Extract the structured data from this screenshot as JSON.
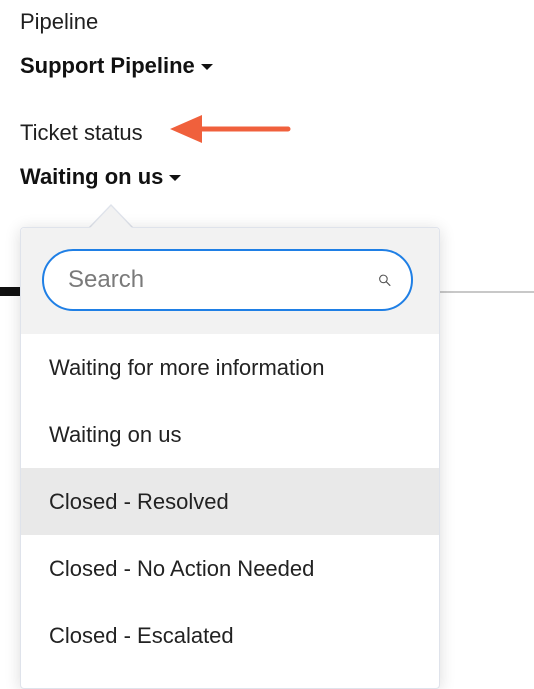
{
  "pipeline": {
    "label": "Pipeline",
    "value": "Support Pipeline"
  },
  "ticket_status": {
    "label": "Ticket status",
    "value": "Waiting on us"
  },
  "search": {
    "placeholder": "Search",
    "icon": "search-icon"
  },
  "options": [
    {
      "label": "Waiting for more information",
      "highlighted": false
    },
    {
      "label": "Waiting on us",
      "highlighted": false
    },
    {
      "label": "Closed - Resolved",
      "highlighted": true
    },
    {
      "label": "Closed - No Action Needed",
      "highlighted": false
    },
    {
      "label": "Closed - Escalated",
      "highlighted": false
    }
  ],
  "colors": {
    "accent": "#1f7fe5",
    "annotation_arrow": "#f0603c",
    "highlight": "#e9e9e9"
  }
}
